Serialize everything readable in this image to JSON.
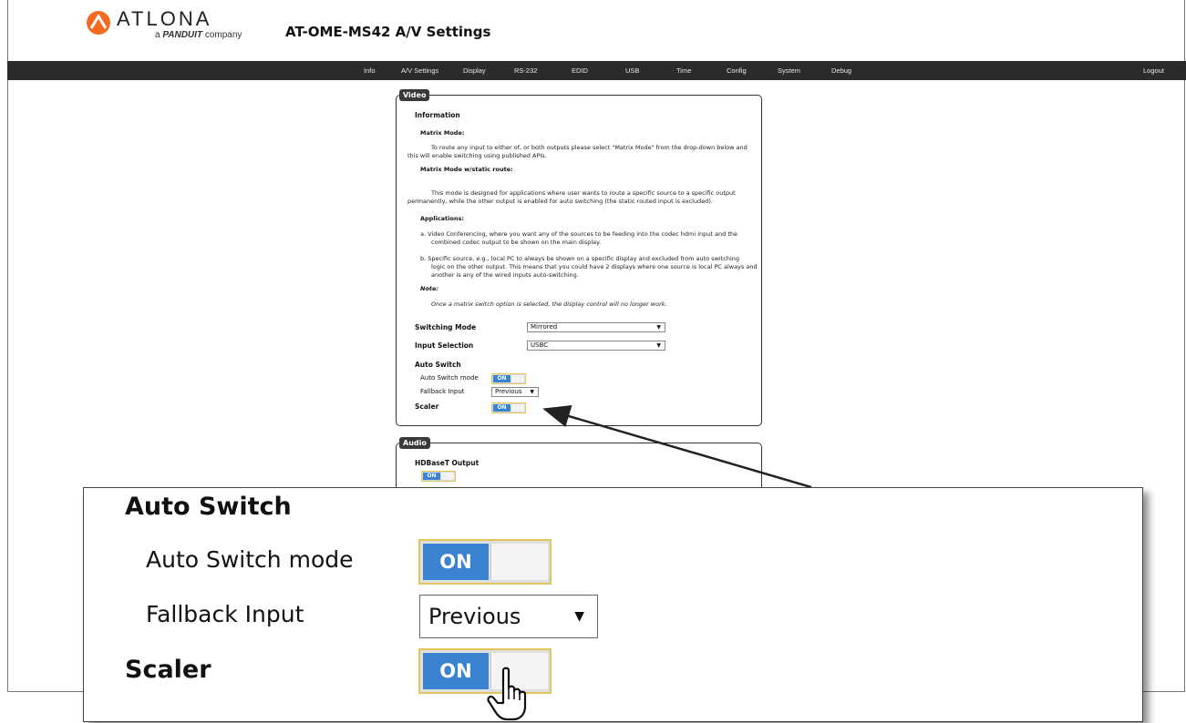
{
  "brand": {
    "name": "ATLONA",
    "tagline_prefix": "a",
    "tagline_brand": "PANDUIT",
    "tagline_suffix": "company"
  },
  "page_title": "AT-OME-MS42  A/V Settings",
  "nav": [
    "Info",
    "A/V Settings",
    "Display",
    "RS-232",
    "EDID",
    "USB",
    "Time",
    "Config",
    "System",
    "Debug"
  ],
  "logout": "Logout",
  "video": {
    "tag": "Video",
    "information_title": "Information",
    "matrix_mode_title": "Matrix Mode:",
    "matrix_mode_text_1": "To route any input to either of, or both outputs please select \"Matrix Mode\" from the drop-down below and",
    "matrix_mode_text_2": "this will enable switching using published APIs.",
    "matrix_static_title": "Matrix Mode w/static route:",
    "matrix_static_text_1": "This mode is designed for applications where user wants to route a specific source to a specific output",
    "matrix_static_text_2": "permanently, while the other output is enabled for auto switching (the static routed input is excluded).",
    "applications_title": "Applications:",
    "app_a_1": "a.  Video Conferencing, where you want any of the sources to be feeding into the codec hdmi input and the",
    "app_a_2": "combined codec output to be shown on the main display.",
    "app_b_1": "b.  Specific source, e.g., local PC to always be shown on a specific display and excluded from auto switching",
    "app_b_2": "logic on the other output. This means that you could have 2 displays where one source is local PC always and",
    "app_b_3": "another is any of the wired inputs auto-switching.",
    "note_title": "Note:",
    "note_text": "Once a matrix switch option is selected, the display control will no longer work.",
    "switching_mode_label": "Switching Mode",
    "switching_mode_value": "Mirrored",
    "input_selection_label": "Input Selection",
    "input_selection_value": "USBC",
    "auto_switch_title": "Auto Switch",
    "auto_switch_mode_label": "Auto Switch mode",
    "auto_switch_mode_state": "ON",
    "fallback_label": "Fallback Input",
    "fallback_value": "Previous",
    "scaler_label": "Scaler",
    "scaler_state": "ON"
  },
  "audio": {
    "tag": "Audio",
    "hdbaset_label": "HDBaseT Output",
    "hdbaset_state": "ON"
  },
  "zoom": {
    "auto_switch_title": "Auto Switch",
    "auto_switch_mode_label": "Auto Switch mode",
    "auto_switch_mode_state": "ON",
    "fallback_label": "Fallback Input",
    "fallback_value": "Previous",
    "scaler_label": "Scaler",
    "scaler_state": "ON"
  },
  "colors": {
    "navbar": "#2b2b2b",
    "toggle_on": "#3a83d0",
    "toggle_border": "#e2c45c",
    "logo_orange": "#f26b21"
  },
  "icons": {
    "logo": "atlona-logo-icon",
    "dropdown": "chevron-down-icon",
    "cursor": "hand-pointer-icon"
  }
}
